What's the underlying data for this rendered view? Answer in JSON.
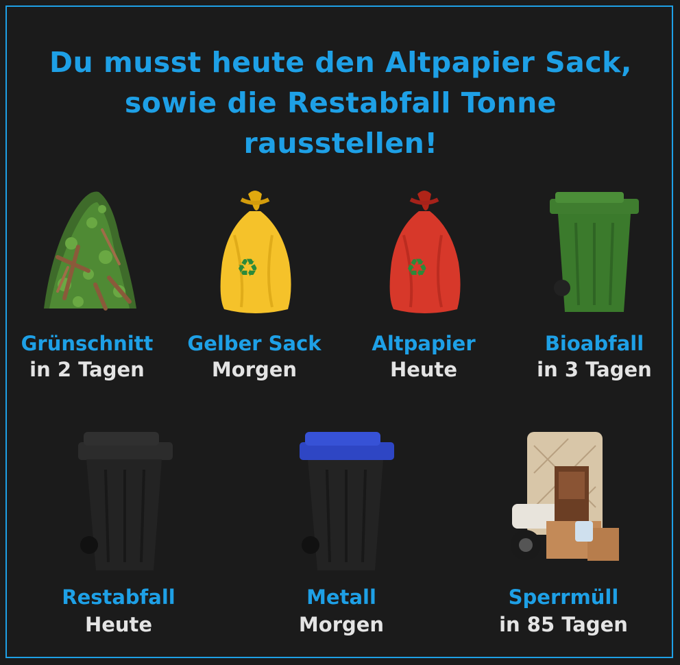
{
  "headline": {
    "line1": "Du musst heute den Altpapier Sack,",
    "line2": "sowie die Restabfall Tonne",
    "line3": "rausstellen!"
  },
  "colors": {
    "accent": "#1ea0e6",
    "text_light": "#e4e4e4",
    "background": "#1b1b1b"
  },
  "items": [
    {
      "name": "Grünschnitt",
      "when": "in 2 Tagen",
      "icon": "green-waste-pile-icon"
    },
    {
      "name": "Gelber Sack",
      "when": "Morgen",
      "icon": "yellow-bag-icon"
    },
    {
      "name": "Altpapier",
      "when": "Heute",
      "icon": "red-bag-icon"
    },
    {
      "name": "Bioabfall",
      "when": "in 3 Tagen",
      "icon": "green-bin-icon"
    },
    {
      "name": "Restabfall",
      "when": "Heute",
      "icon": "black-bin-icon"
    },
    {
      "name": "Metall",
      "when": "Morgen",
      "icon": "blue-lid-bin-icon"
    },
    {
      "name": "Sperrmüll",
      "when": "in 85 Tagen",
      "icon": "bulky-waste-icon"
    }
  ]
}
